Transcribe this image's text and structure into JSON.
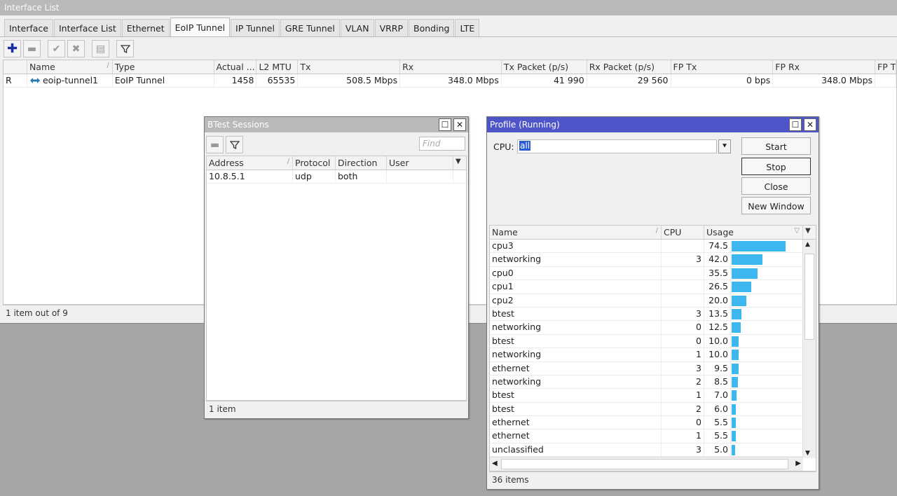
{
  "main": {
    "title": "Interface List",
    "tabs": [
      "Interface",
      "Interface List",
      "Ethernet",
      "EoIP Tunnel",
      "IP Tunnel",
      "GRE Tunnel",
      "VLAN",
      "VRRP",
      "Bonding",
      "LTE"
    ],
    "active_tab": "EoIP Tunnel",
    "columns": [
      "Name",
      "Type",
      "Actual ...",
      "L2 MTU",
      "Tx",
      "Rx",
      "Tx Packet (p/s)",
      "Rx Packet (p/s)",
      "FP Tx",
      "FP Rx",
      "FP Tx"
    ],
    "rows": [
      {
        "flag": "R",
        "name": "eoip-tunnel1",
        "type": "EoIP Tunnel",
        "actual_mtu": "1458",
        "l2mtu": "65535",
        "tx": "508.5 Mbps",
        "rx": "348.0 Mbps",
        "txp": "41 990",
        "rxp": "29 560",
        "fptx": "0 bps",
        "fprx": "348.0 Mbps",
        "fptx2": ""
      }
    ],
    "status": "1 item out of 9"
  },
  "btest": {
    "title": "BTest Sessions",
    "find_placeholder": "Find",
    "columns": [
      "Address",
      "Protocol",
      "Direction",
      "User"
    ],
    "rows": [
      {
        "address": "10.8.5.1",
        "protocol": "udp",
        "direction": "both",
        "user": ""
      }
    ],
    "status": "1 item"
  },
  "profile": {
    "title": "Profile (Running)",
    "cpu_label": "CPU:",
    "cpu_value": "all",
    "buttons": {
      "start": "Start",
      "stop": "Stop",
      "close": "Close",
      "new_window": "New Window"
    },
    "columns": [
      "Name",
      "CPU",
      "Usage"
    ],
    "rows": [
      {
        "name": "cpu3",
        "cpu": "",
        "usage": "74.5"
      },
      {
        "name": "networking",
        "cpu": "3",
        "usage": "42.0"
      },
      {
        "name": "cpu0",
        "cpu": "",
        "usage": "35.5"
      },
      {
        "name": "cpu1",
        "cpu": "",
        "usage": "26.5"
      },
      {
        "name": "cpu2",
        "cpu": "",
        "usage": "20.0"
      },
      {
        "name": "btest",
        "cpu": "3",
        "usage": "13.5"
      },
      {
        "name": "networking",
        "cpu": "0",
        "usage": "12.5"
      },
      {
        "name": "btest",
        "cpu": "0",
        "usage": "10.0"
      },
      {
        "name": "networking",
        "cpu": "1",
        "usage": "10.0"
      },
      {
        "name": "ethernet",
        "cpu": "3",
        "usage": "9.5"
      },
      {
        "name": "networking",
        "cpu": "2",
        "usage": "8.5"
      },
      {
        "name": "btest",
        "cpu": "1",
        "usage": "7.0"
      },
      {
        "name": "btest",
        "cpu": "2",
        "usage": "6.0"
      },
      {
        "name": "ethernet",
        "cpu": "0",
        "usage": "5.5"
      },
      {
        "name": "ethernet",
        "cpu": "1",
        "usage": "5.5"
      },
      {
        "name": "unclassified",
        "cpu": "3",
        "usage": "5.0"
      }
    ],
    "status": "36 items",
    "bar_color": "#3cb7ef"
  }
}
